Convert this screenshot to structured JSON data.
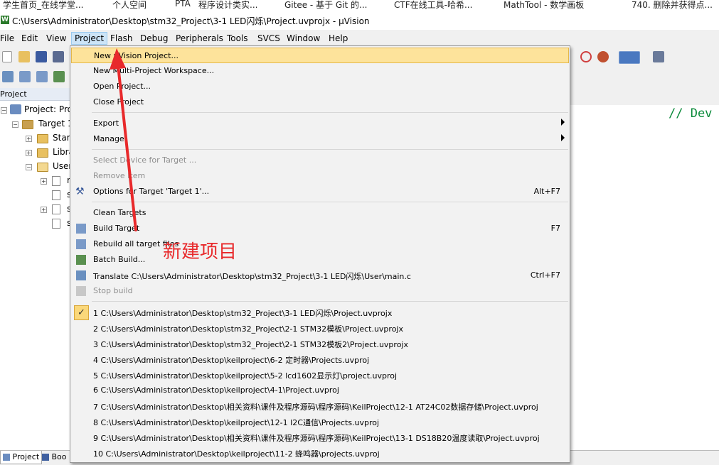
{
  "bookmarks": [
    "学生首页_在线学堂...",
    "个人空间",
    "PTA",
    "程序设计类实...",
    "Gitee - 基于 Git 的...",
    "CTF在线工具-哈希...",
    "MathTool - 数学画板",
    "740. 删除并获得点..."
  ],
  "window": {
    "title": "C:\\Users\\Administrator\\Desktop\\stm32_Project\\3-1 LED闪烁\\Project.uvprojx - µVision"
  },
  "menubar": [
    "File",
    "Edit",
    "View",
    "Project",
    "Flash",
    "Debug",
    "Peripherals",
    "Tools",
    "SVCS",
    "Window",
    "Help"
  ],
  "project_pane": {
    "header": "Project",
    "tree": [
      "Project: Proj",
      "Target 1",
      "Start",
      "Libra",
      "User",
      "m",
      "s",
      "s",
      "s"
    ]
  },
  "editor": {
    "code_line": "// Dev"
  },
  "bottom_tabs": [
    "Project",
    "Boo"
  ],
  "project_menu": {
    "items": [
      {
        "label": "New µVision Project...",
        "shortcut": "",
        "disabled": false,
        "icon": ""
      },
      {
        "label": "New Multi-Project Workspace...",
        "shortcut": "",
        "disabled": false,
        "icon": ""
      },
      {
        "label": "Open Project...",
        "shortcut": "",
        "disabled": false,
        "icon": ""
      },
      {
        "label": "Close Project",
        "shortcut": "",
        "disabled": false,
        "icon": ""
      },
      {
        "label": "Export",
        "shortcut": "",
        "disabled": false,
        "icon": "submenu"
      },
      {
        "label": "Manage",
        "shortcut": "",
        "disabled": false,
        "icon": "submenu"
      },
      {
        "label": "Select Device for Target ...",
        "shortcut": "",
        "disabled": true,
        "icon": ""
      },
      {
        "label": "Remove Item",
        "shortcut": "",
        "disabled": true,
        "icon": ""
      },
      {
        "label": "Options for Target 'Target 1'...",
        "shortcut": "Alt+F7",
        "disabled": false,
        "icon": "options-icon"
      },
      {
        "label": "Clean Targets",
        "shortcut": "",
        "disabled": false,
        "icon": ""
      },
      {
        "label": "Build Target",
        "shortcut": "F7",
        "disabled": false,
        "icon": "build-icon"
      },
      {
        "label": "Rebuild all target files",
        "shortcut": "",
        "disabled": false,
        "icon": "rebuild-icon"
      },
      {
        "label": "Batch Build...",
        "shortcut": "",
        "disabled": false,
        "icon": "batch-build-icon"
      },
      {
        "label": "Translate C:\\Users\\Administrator\\Desktop\\stm32_Project\\3-1 LED闪烁\\User\\main.c",
        "shortcut": "Ctrl+F7",
        "disabled": false,
        "icon": "translate-icon"
      },
      {
        "label": "Stop build",
        "shortcut": "",
        "disabled": true,
        "icon": "stop-build-icon"
      }
    ],
    "recent": [
      "1 C:\\Users\\Administrator\\Desktop\\stm32_Project\\3-1 LED闪烁\\Project.uvprojx",
      "2 C:\\Users\\Administrator\\Desktop\\stm32_Project\\2-1 STM32模板\\Project.uvprojx",
      "3 C:\\Users\\Administrator\\Desktop\\stm32_Project\\2-1 STM32模板2\\Project.uvprojx",
      "4 C:\\Users\\Administrator\\Desktop\\keilproject\\6-2 定时器\\Projects.uvproj",
      "5 C:\\Users\\Administrator\\Desktop\\keilproject\\5-2 lcd1602显示灯\\project.uvproj",
      "6 C:\\Users\\Administrator\\Desktop\\keilproject\\4-1\\Project.uvproj",
      "7 C:\\Users\\Administrator\\Desktop\\相关资料\\课件及程序源码\\程序源码\\KeilProject\\12-1 AT24C02数据存储\\Project.uvproj",
      "8 C:\\Users\\Administrator\\Desktop\\keilproject\\12-1 I2C通信\\Projects.uvproj",
      "9 C:\\Users\\Administrator\\Desktop\\相关资料\\课件及程序源码\\程序源码\\KeilProject\\13-1 DS18B20温度读取\\Project.uvproj",
      "10 C:\\Users\\Administrator\\Desktop\\keilproject\\11-2 蜂鸣器\\projects.uvproj"
    ]
  },
  "annotation": {
    "text": "新建项目",
    "color": "#e8292b"
  }
}
